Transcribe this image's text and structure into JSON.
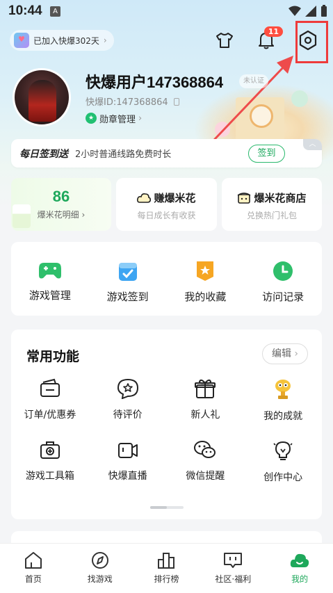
{
  "status_bar": {
    "time": "10:44",
    "notif_letter": "A"
  },
  "header": {
    "join_text": "已加入快爆302天",
    "join_chevron": "›",
    "notification_count": "11"
  },
  "profile": {
    "username": "快爆用户147368864",
    "edit_tag": "未认证",
    "user_id": "快爆ID:147368864",
    "medal_label": "勋章管理",
    "medal_chevron": "›"
  },
  "signin": {
    "title": "每日签到送",
    "description": "2小时普通线路免费时长",
    "button": "签到",
    "collapse": "︿"
  },
  "stats": {
    "popcorn_count": "86",
    "popcorn_detail": "爆米花明细",
    "popcorn_chevron": "›",
    "earn_title": "赚爆米花",
    "earn_sub": "每日成长有收获",
    "shop_title": "爆米花商店",
    "shop_sub": "兑换热门礼包"
  },
  "games": [
    {
      "label": "游戏管理",
      "icon": "gamepad-icon",
      "color": "#2fbf6b"
    },
    {
      "label": "游戏签到",
      "icon": "calendar-check-icon",
      "color": "#3ea5f2"
    },
    {
      "label": "我的收藏",
      "icon": "star-ribbon-icon",
      "color": "#f6a623"
    },
    {
      "label": "访问记录",
      "icon": "clock-icon",
      "color": "#2fbf6b"
    }
  ],
  "common": {
    "title": "常用功能",
    "edit_label": "编辑",
    "edit_chevron": "›",
    "items": [
      {
        "label": "订单/优惠券",
        "icon": "wallet-icon"
      },
      {
        "label": "待评价",
        "icon": "review-star-icon"
      },
      {
        "label": "新人礼",
        "icon": "gift-icon"
      },
      {
        "label": "我的成就",
        "icon": "trophy-icon"
      },
      {
        "label": "游戏工具箱",
        "icon": "toolbox-icon"
      },
      {
        "label": "快爆直播",
        "icon": "camera-icon"
      },
      {
        "label": "微信提醒",
        "icon": "wechat-icon"
      },
      {
        "label": "创作中心",
        "icon": "lightbulb-icon"
      }
    ]
  },
  "bottom_nav": [
    {
      "label": "首页",
      "icon": "home-icon"
    },
    {
      "label": "找游戏",
      "icon": "compass-icon"
    },
    {
      "label": "排行榜",
      "icon": "ranking-icon"
    },
    {
      "label": "社区·福利",
      "icon": "community-icon"
    },
    {
      "label": "我的",
      "icon": "profile-icon",
      "active": true
    }
  ],
  "colors": {
    "accent": "#1ea85b",
    "highlight": "#ee3b3b",
    "badge": "#ff4d3f"
  }
}
